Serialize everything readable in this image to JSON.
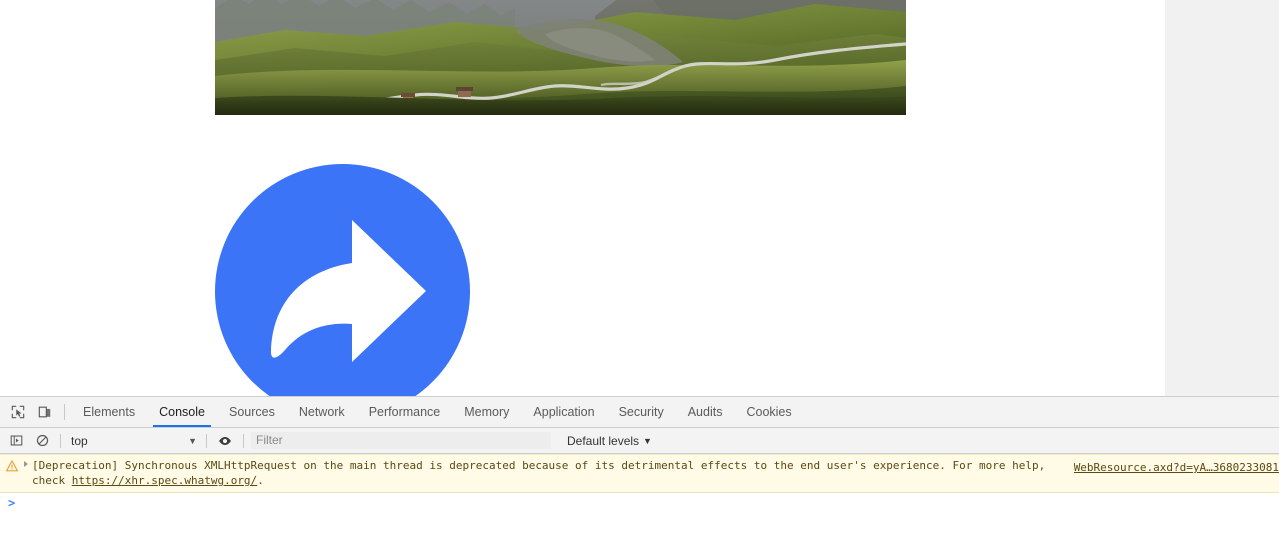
{
  "page": {
    "hero_image": {
      "alt": "alpine-mountain-landscape-with-winding-road",
      "description": "Green alpine meadow with winding mountain road and rocky peaks"
    },
    "share_badge": {
      "icon": "share-arrow-icon",
      "circle_color": "#3b74f6",
      "arrow_color": "#ffffff"
    }
  },
  "devtools": {
    "toolbar_icons": [
      {
        "name": "inspect-element-icon",
        "title": "Inspect element"
      },
      {
        "name": "device-toolbar-icon",
        "title": "Toggle device toolbar"
      }
    ],
    "tabs": [
      {
        "label": "Elements",
        "active": false
      },
      {
        "label": "Console",
        "active": true
      },
      {
        "label": "Sources",
        "active": false
      },
      {
        "label": "Network",
        "active": false
      },
      {
        "label": "Performance",
        "active": false
      },
      {
        "label": "Memory",
        "active": false
      },
      {
        "label": "Application",
        "active": false
      },
      {
        "label": "Security",
        "active": false
      },
      {
        "label": "Audits",
        "active": false
      },
      {
        "label": "Cookies",
        "active": false
      }
    ],
    "controlbar": {
      "sidebar_toggle_icon": "console-sidebar-icon",
      "clear_icon": "clear-console-icon",
      "context_value": "top",
      "context_caret": "▼",
      "eye_icon": "live-expression-eye-icon",
      "filter_placeholder": "Filter",
      "filter_value": "",
      "levels_label": "Default levels",
      "levels_caret": "▼"
    },
    "console": {
      "messages": [
        {
          "level": "warning",
          "icon": "warning-triangle-icon",
          "expander": "disclosure-triangle-icon",
          "text": "[Deprecation] Synchronous XMLHttpRequest on the main thread is deprecated because of its detrimental effects to the end user's experience. For more help, check ",
          "link_text": "https://xhr.spec.whatwg.org/",
          "text_tail": ".",
          "source": "WebResource.axd?d=yA…3680233081"
        }
      ],
      "prompt_caret": ">",
      "prompt_value": ""
    }
  },
  "colors": {
    "accent_blue": "#1a73e8",
    "badge_blue": "#3b74f6",
    "warning_bg": "#fffbe6",
    "warning_text": "#5c4813",
    "panel_bg": "#f3f3f3"
  }
}
